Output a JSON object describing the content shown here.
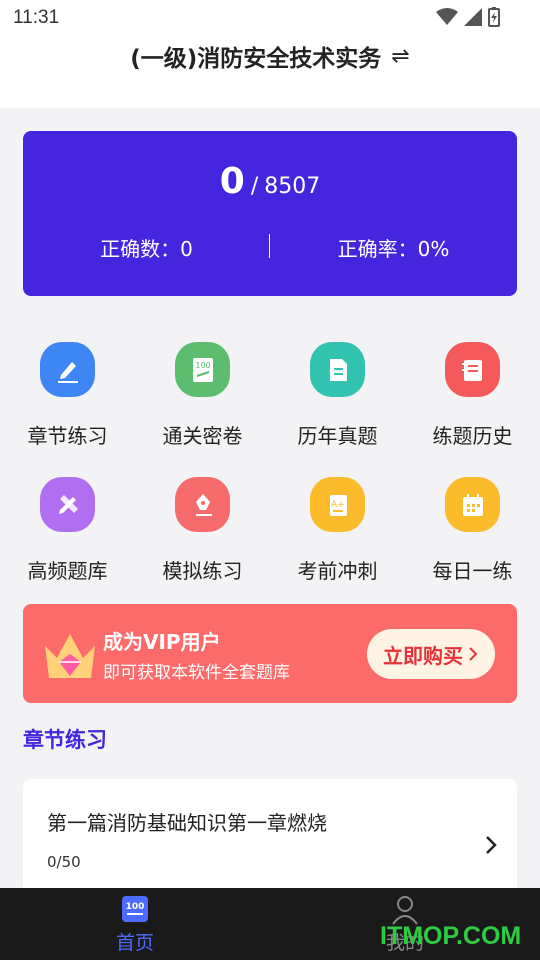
{
  "status_bar": {
    "time": "11:31"
  },
  "header": {
    "title": "(一级)消防安全技术实务",
    "switch_icon": "⇌"
  },
  "stats": {
    "answered": "0",
    "separator": "/",
    "total": "8507",
    "correct_count_label": "正确数：0",
    "correct_rate_label": "正确率：0%"
  },
  "grid": [
    {
      "label": "章节练习",
      "icon": "pencil-icon",
      "color": "#3f86f5"
    },
    {
      "label": "通关密卷",
      "icon": "exam-paper-icon",
      "color": "#5cbd6f"
    },
    {
      "label": "历年真题",
      "icon": "document-icon",
      "color": "#31c2b0"
    },
    {
      "label": "练题历史",
      "icon": "notebook-icon",
      "color": "#f45a5c"
    },
    {
      "label": "高频题库",
      "icon": "pencil-ruler-icon",
      "color": "#b06ef0"
    },
    {
      "label": "模拟练习",
      "icon": "pen-icon",
      "color": "#f66b6c"
    },
    {
      "label": "考前冲刺",
      "icon": "grade-paper-icon",
      "color": "#fbbb2b"
    },
    {
      "label": "每日一练",
      "icon": "calendar-icon",
      "color": "#fbbb2b"
    }
  ],
  "grid_badge": "100",
  "vip": {
    "title": "成为VIP用户",
    "subtitle": "即可获取本软件全套题库",
    "button": "立即购买"
  },
  "section": {
    "title": "章节练习"
  },
  "chapter": {
    "name": "第一篇消防基础知识第一章燃烧",
    "progress": "0/50"
  },
  "nav": {
    "home": "首页",
    "home_badge": "100",
    "mine": "我的"
  },
  "watermark": "ITMOP.COM",
  "colors": {
    "accent": "#4525dd",
    "vip": "#fd6a6a",
    "nav_active": "#4f6bff"
  }
}
